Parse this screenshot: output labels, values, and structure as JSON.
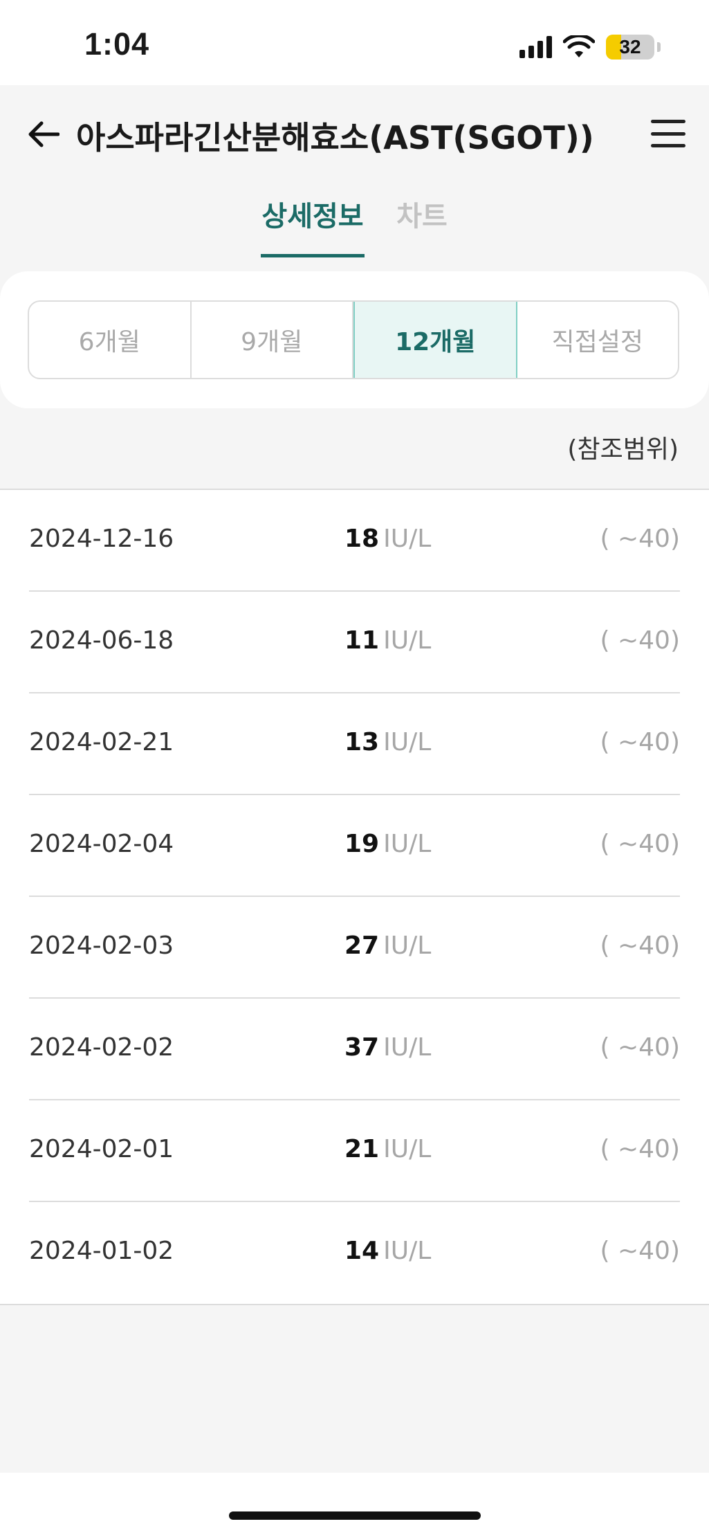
{
  "status_bar": {
    "time": "1:04",
    "battery": "32",
    "icons": [
      "signal-icon",
      "wifi-icon",
      "battery-icon"
    ]
  },
  "header": {
    "title": "아스파라긴산분해효소(AST(SGOT))",
    "back_icon": "arrow-left-icon",
    "menu_icon": "hamburger-menu-icon"
  },
  "tabs": [
    {
      "label": "상세정보",
      "active": true
    },
    {
      "label": "차트",
      "active": false
    }
  ],
  "period_options": [
    {
      "label": "6개월",
      "active": false
    },
    {
      "label": "9개월",
      "active": false
    },
    {
      "label": "12개월",
      "active": true
    },
    {
      "label": "직접설정",
      "active": false
    }
  ],
  "reference_label": "(참조범위)",
  "results": [
    {
      "date": "2024-12-16",
      "value": "18",
      "unit": "IU/L",
      "range": "( ~40)"
    },
    {
      "date": "2024-06-18",
      "value": "11",
      "unit": "IU/L",
      "range": "( ~40)"
    },
    {
      "date": "2024-02-21",
      "value": "13",
      "unit": "IU/L",
      "range": "( ~40)"
    },
    {
      "date": "2024-02-04",
      "value": "19",
      "unit": "IU/L",
      "range": "( ~40)"
    },
    {
      "date": "2024-02-03",
      "value": "27",
      "unit": "IU/L",
      "range": "( ~40)"
    },
    {
      "date": "2024-02-02",
      "value": "37",
      "unit": "IU/L",
      "range": "( ~40)"
    },
    {
      "date": "2024-02-01",
      "value": "21",
      "unit": "IU/L",
      "range": "( ~40)"
    },
    {
      "date": "2024-01-02",
      "value": "14",
      "unit": "IU/L",
      "range": "( ~40)"
    }
  ],
  "colors": {
    "accent": "#1b6b66",
    "accent_bg": "#e8f6f4",
    "muted": "#a6a6a6",
    "background": "#f5f5f5"
  }
}
